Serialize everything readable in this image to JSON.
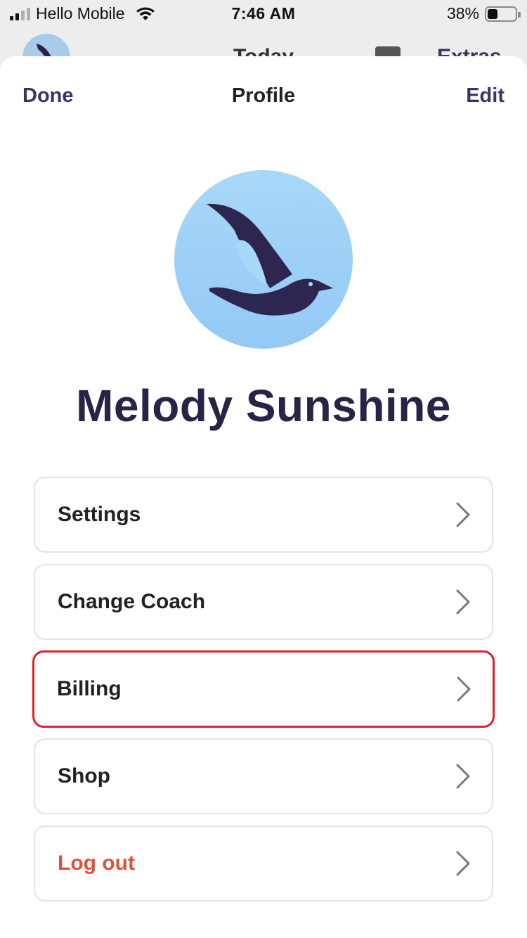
{
  "status_bar": {
    "carrier": "Hello Mobile",
    "time": "7:46 AM",
    "battery_percent": "38%",
    "battery_level": 0.38,
    "signal_bars_active": 2,
    "signal_bars_total": 4
  },
  "background_app": {
    "title": "Today",
    "extras_label": "Extras"
  },
  "sheet": {
    "done_label": "Done",
    "title": "Profile",
    "edit_label": "Edit"
  },
  "profile": {
    "name": "Melody Sunshine",
    "avatar_icon": "bird-logo-icon"
  },
  "menu": {
    "items": [
      {
        "label": "Settings",
        "style": "normal",
        "highlighted": false
      },
      {
        "label": "Change Coach",
        "style": "normal",
        "highlighted": false
      },
      {
        "label": "Billing",
        "style": "normal",
        "highlighted": true
      },
      {
        "label": "Shop",
        "style": "normal",
        "highlighted": false
      },
      {
        "label": "Log out",
        "style": "danger",
        "highlighted": false
      }
    ]
  },
  "colors": {
    "accent": "#3b3366",
    "name_color": "#2a2347",
    "danger": "#d9533d",
    "highlight_border": "#e0202e",
    "avatar_bg": "#a8d8f8"
  }
}
